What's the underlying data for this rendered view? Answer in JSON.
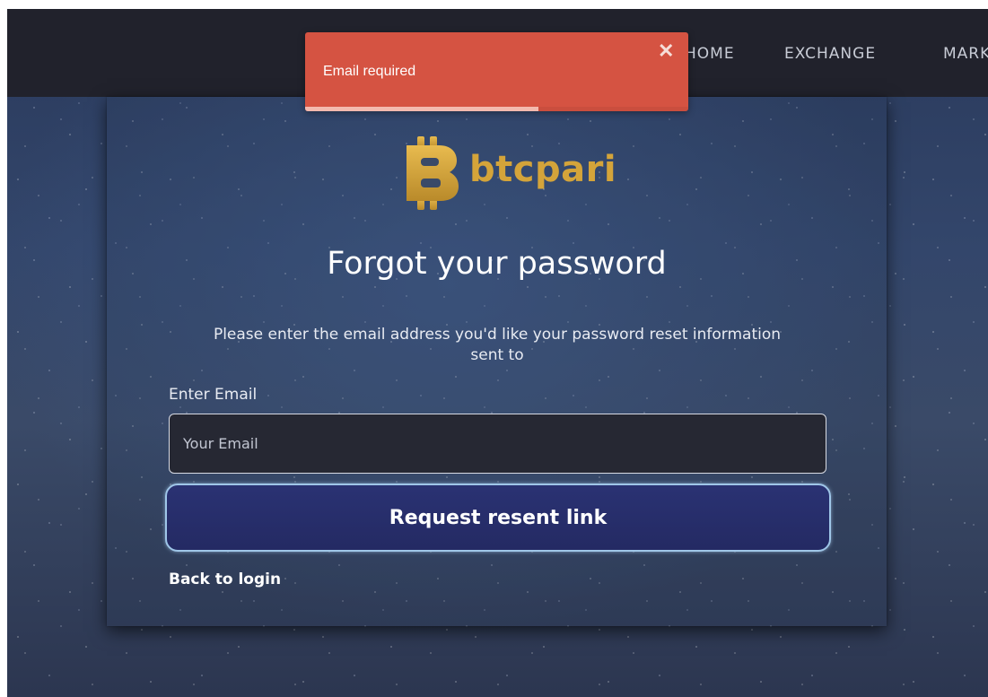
{
  "nav": {
    "items": [
      {
        "label": "HOME"
      },
      {
        "label": "EXCHANGE"
      },
      {
        "label": "MARKETS"
      }
    ]
  },
  "toast": {
    "message": "Email required",
    "close_symbol": "✕",
    "progress": 0.61,
    "color": "#d55342"
  },
  "brand": {
    "name": "btcpari",
    "logo_color": "#d4a43a",
    "icon": "bitcoin-b-icon"
  },
  "form": {
    "title": "Forgot your password",
    "subtitle": "Please enter the email address you'd like your password reset information sent to",
    "email_label": "Enter Email",
    "email_placeholder": "Your Email",
    "email_value": "",
    "submit_label": "Request resent link",
    "back_link": "Back to login"
  }
}
